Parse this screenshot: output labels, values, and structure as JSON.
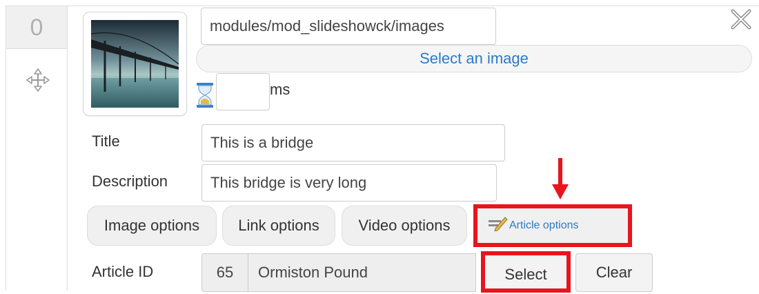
{
  "slide": {
    "index": "0",
    "image_path": "modules/mod_slideshowck/images",
    "select_image_label": "Select an image",
    "duration_value": "",
    "duration_unit": "ms"
  },
  "fields": {
    "title_label": "Title",
    "title_value": "This is a bridge",
    "description_label": "Description",
    "description_value": "This bridge is very long"
  },
  "options": {
    "image_options": "Image options",
    "link_options": "Link options",
    "video_options": "Video options",
    "article_options": "Article options"
  },
  "article": {
    "id_label": "Article ID",
    "id_value": "65",
    "name_value": "Ormiston Pound",
    "select_label": "Select",
    "clear_label": "Clear"
  },
  "colors": {
    "link_blue": "#2a7ac8",
    "highlight_red": "#e8141e"
  },
  "icons": [
    "move-icon",
    "hourglass-icon",
    "close-icon",
    "pen-icon",
    "arrow-down-icon"
  ]
}
